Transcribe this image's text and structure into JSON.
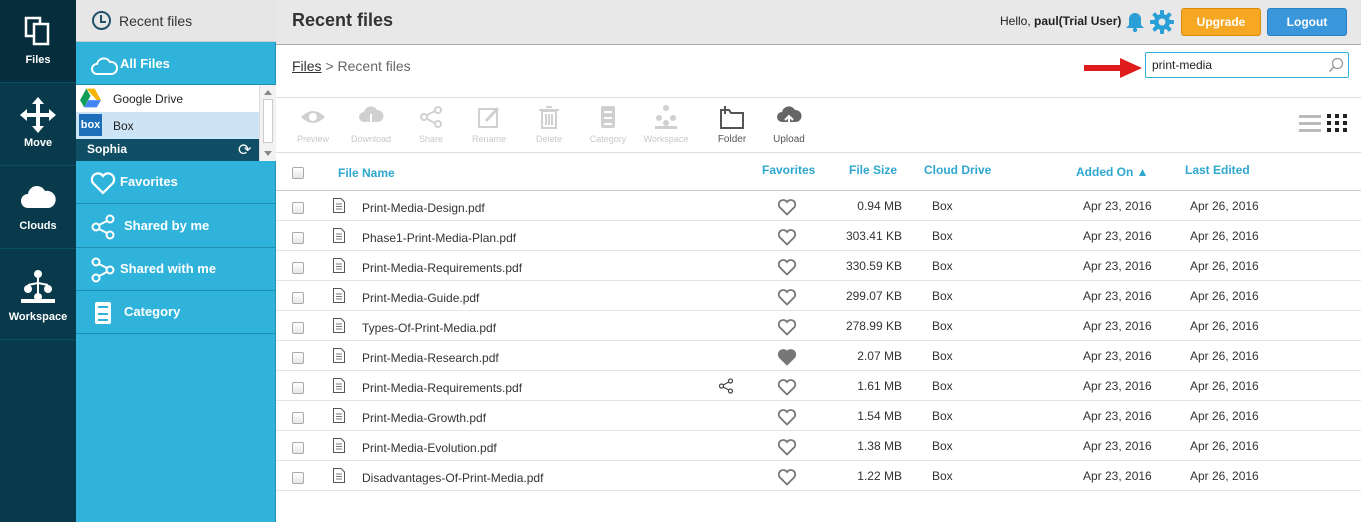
{
  "rail": {
    "items": [
      {
        "label": "Files"
      },
      {
        "label": "Move"
      },
      {
        "label": "Clouds"
      },
      {
        "label": "Workspace"
      }
    ]
  },
  "sidebar": {
    "recent_label": "Recent files",
    "all_files_label": "All Files",
    "drives": [
      {
        "label": "Google Drive"
      },
      {
        "label": "Box"
      }
    ],
    "sub_user": "Sophia",
    "items": [
      {
        "label": "Favorites"
      },
      {
        "label": "Shared by me"
      },
      {
        "label": "Shared with me"
      },
      {
        "label": "Category"
      }
    ]
  },
  "header": {
    "title": "Recent files",
    "greeting_prefix": "Hello, ",
    "user": "paul(Trial User)",
    "upgrade_label": "Upgrade",
    "logout_label": "Logout"
  },
  "breadcrumb": {
    "root": "Files",
    "separator": " > ",
    "current": "Recent files"
  },
  "search": {
    "value": "print-media"
  },
  "toolbar": {
    "items": [
      {
        "label": "Preview",
        "enabled": false
      },
      {
        "label": "Download",
        "enabled": false
      },
      {
        "label": "Share",
        "enabled": false
      },
      {
        "label": "Rename",
        "enabled": false
      },
      {
        "label": "Delete",
        "enabled": false
      },
      {
        "label": "Category",
        "enabled": false
      },
      {
        "label": "Workspace",
        "enabled": false
      },
      {
        "label": "Folder",
        "enabled": true
      },
      {
        "label": "Upload",
        "enabled": true
      }
    ]
  },
  "table": {
    "columns": {
      "file_name": "File Name",
      "favorites": "Favorites",
      "file_size": "File Size",
      "cloud_drive": "Cloud Drive",
      "added_on": "Added On ▲",
      "last_edited": "Last Edited"
    },
    "rows": [
      {
        "name": "Print-Media-Design.pdf",
        "size": "0.94 MB",
        "drive": "Box",
        "added": "Apr 23, 2016",
        "edited": "Apr 26, 2016",
        "favorite": false,
        "shared": false
      },
      {
        "name": "Phase1-Print-Media-Plan.pdf",
        "size": "303.41 KB",
        "drive": "Box",
        "added": "Apr 23, 2016",
        "edited": "Apr 26, 2016",
        "favorite": false,
        "shared": false
      },
      {
        "name": "Print-Media-Requirements.pdf",
        "size": "330.59 KB",
        "drive": "Box",
        "added": "Apr 23, 2016",
        "edited": "Apr 26, 2016",
        "favorite": false,
        "shared": false
      },
      {
        "name": "Print-Media-Guide.pdf",
        "size": "299.07 KB",
        "drive": "Box",
        "added": "Apr 23, 2016",
        "edited": "Apr 26, 2016",
        "favorite": false,
        "shared": false
      },
      {
        "name": "Types-Of-Print-Media.pdf",
        "size": "278.99 KB",
        "drive": "Box",
        "added": "Apr 23, 2016",
        "edited": "Apr 26, 2016",
        "favorite": false,
        "shared": false
      },
      {
        "name": "Print-Media-Research.pdf",
        "size": "2.07 MB",
        "drive": "Box",
        "added": "Apr 23, 2016",
        "edited": "Apr 26, 2016",
        "favorite": true,
        "shared": false
      },
      {
        "name": "Print-Media-Requirements.pdf",
        "size": "1.61 MB",
        "drive": "Box",
        "added": "Apr 23, 2016",
        "edited": "Apr 26, 2016",
        "favorite": false,
        "shared": true
      },
      {
        "name": "Print-Media-Growth.pdf",
        "size": "1.54 MB",
        "drive": "Box",
        "added": "Apr 23, 2016",
        "edited": "Apr 26, 2016",
        "favorite": false,
        "shared": false
      },
      {
        "name": "Print-Media-Evolution.pdf",
        "size": "1.38 MB",
        "drive": "Box",
        "added": "Apr 23, 2016",
        "edited": "Apr 26, 2016",
        "favorite": false,
        "shared": false
      },
      {
        "name": "Disadvantages-Of-Print-Media.pdf",
        "size": "1.22 MB",
        "drive": "Box",
        "added": "Apr 23, 2016",
        "edited": "Apr 26, 2016",
        "favorite": false,
        "shared": false
      }
    ]
  },
  "colors": {
    "accent": "#2fb3db",
    "rail": "#083a4c",
    "upgrade": "#f7a823",
    "logout": "#3b97dc",
    "annotation_arrow": "#e01b1b"
  }
}
